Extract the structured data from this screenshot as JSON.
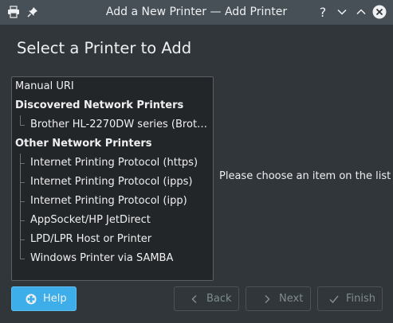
{
  "window": {
    "title": "Add a New Printer — Add Printer",
    "help_glyph": "?"
  },
  "page": {
    "heading": "Select a Printer to Add"
  },
  "tree": {
    "manual": "Manual URI",
    "discovered": {
      "label": "Discovered Network Printers",
      "items": [
        "Brother HL-2270DW series (Brother..."
      ]
    },
    "other": {
      "label": "Other Network Printers",
      "items": [
        "Internet Printing Protocol (https)",
        "Internet Printing Protocol (ipps)",
        "Internet Printing Protocol (ipp)",
        "AppSocket/HP JetDirect",
        "LPD/LPR Host or Printer",
        "Windows Printer via SAMBA"
      ]
    }
  },
  "message": "Please choose an item on the list",
  "buttons": {
    "help": "Help",
    "back": "Back",
    "next": "Next",
    "finish": "Finish"
  },
  "colors": {
    "accent": "#3daee9",
    "window_bg": "#31363b",
    "titlebar_bg": "#475057",
    "list_bg": "#232629"
  }
}
